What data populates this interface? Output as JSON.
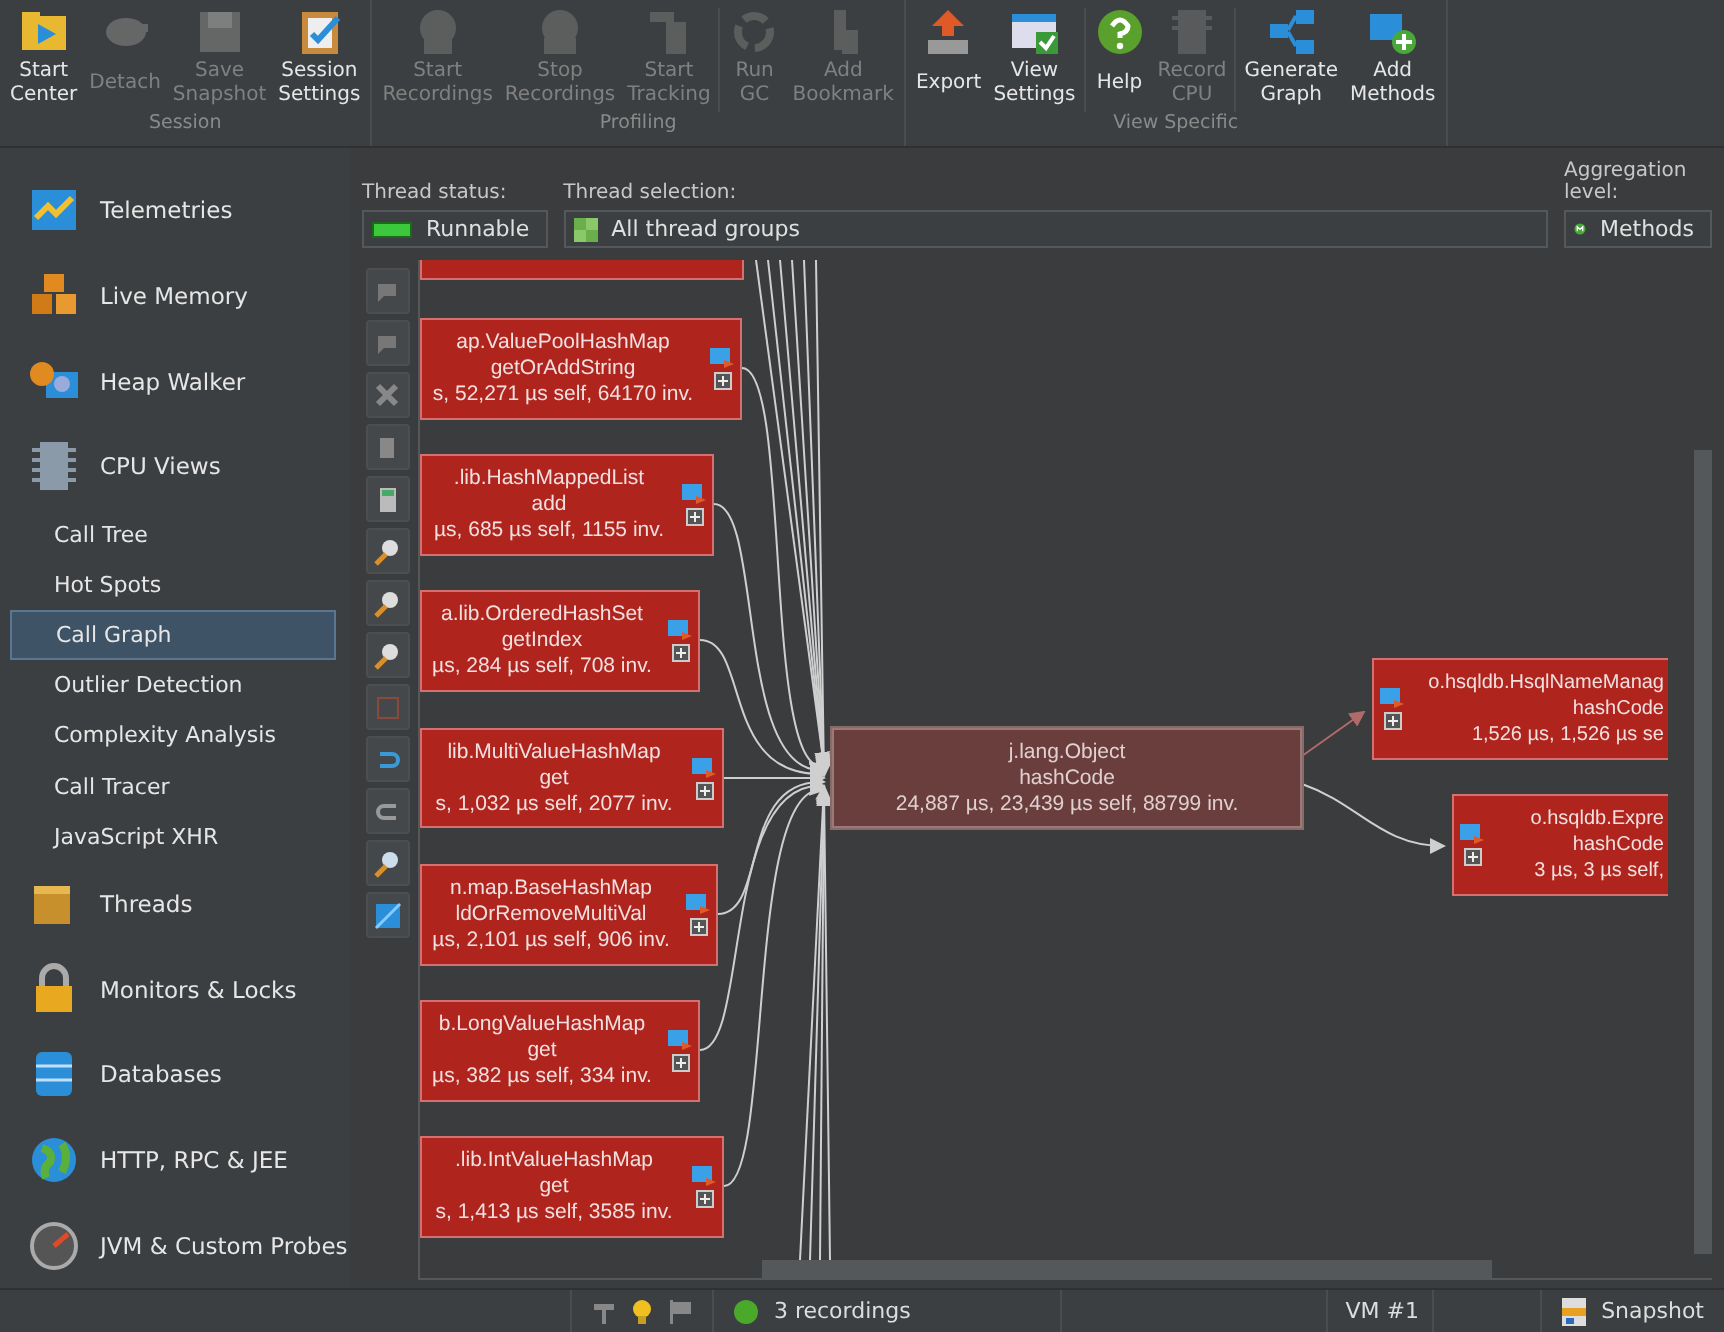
{
  "toolbar": {
    "groups": [
      {
        "label": "Session",
        "buttons": [
          {
            "label": "Start Center",
            "disabled": false
          },
          {
            "label": "Detach",
            "disabled": true
          },
          {
            "label": "Save Snapshot",
            "disabled": true
          },
          {
            "label": "Session Settings",
            "disabled": false
          }
        ]
      },
      {
        "label": "Profiling",
        "buttons": [
          {
            "label": "Start Recordings",
            "disabled": true
          },
          {
            "label": "Stop Recordings",
            "disabled": true
          },
          {
            "label": "Start Tracking",
            "disabled": true
          },
          {
            "label": "Run GC",
            "disabled": true
          },
          {
            "label": "Add Bookmark",
            "disabled": true
          }
        ]
      },
      {
        "label": "View Specific",
        "buttons": [
          {
            "label": "Export",
            "disabled": false
          },
          {
            "label": "View Settings",
            "disabled": false
          },
          {
            "label": "Help",
            "disabled": false
          },
          {
            "label": "Record CPU",
            "disabled": true
          },
          {
            "label": "Generate Graph",
            "disabled": false
          },
          {
            "label": "Add Methods",
            "disabled": false
          }
        ]
      }
    ]
  },
  "sidebar": {
    "items": [
      {
        "label": "Telemetries",
        "kind": "section",
        "selected": false
      },
      {
        "label": "Live Memory",
        "kind": "section",
        "selected": false
      },
      {
        "label": "Heap Walker",
        "kind": "section",
        "selected": false
      },
      {
        "label": "CPU Views",
        "kind": "section",
        "selected": false
      },
      {
        "label": "Call Tree",
        "kind": "sub",
        "selected": false
      },
      {
        "label": "Hot Spots",
        "kind": "sub",
        "selected": false
      },
      {
        "label": "Call Graph",
        "kind": "sub",
        "selected": true
      },
      {
        "label": "Outlier Detection",
        "kind": "sub",
        "selected": false
      },
      {
        "label": "Complexity Analysis",
        "kind": "sub",
        "selected": false
      },
      {
        "label": "Call Tracer",
        "kind": "sub",
        "selected": false
      },
      {
        "label": "JavaScript XHR",
        "kind": "sub",
        "selected": false
      },
      {
        "label": "Threads",
        "kind": "section",
        "selected": false
      },
      {
        "label": "Monitors & Locks",
        "kind": "section",
        "selected": false
      },
      {
        "label": "Databases",
        "kind": "section",
        "selected": false
      },
      {
        "label": "HTTP, RPC & JEE",
        "kind": "section",
        "selected": false
      },
      {
        "label": "JVM & Custom Probes",
        "kind": "section",
        "selected": false
      }
    ]
  },
  "filters": {
    "thread_status": {
      "label": "Thread status:",
      "value": "Runnable"
    },
    "thread_selection": {
      "label": "Thread selection:",
      "value": "All thread groups"
    },
    "aggregation_level": {
      "label": "Aggregation level:",
      "value": "Methods"
    }
  },
  "graph": {
    "nodes": [
      {
        "kind": "caller",
        "selected": false
      },
      {
        "kind": "caller",
        "selected": false,
        "lines": [
          "ap.ValuePoolHashMap",
          "getOrAddString",
          "s, 52,271 µs self, 64170 inv."
        ]
      },
      {
        "kind": "caller",
        "selected": false,
        "lines": [
          ".lib.HashMappedList",
          "add",
          "µs, 685 µs self, 1155 inv."
        ]
      },
      {
        "kind": "caller",
        "selected": false,
        "lines": [
          "a.lib.OrderedHashSet",
          "getIndex",
          "µs, 284 µs self, 708 inv."
        ]
      },
      {
        "kind": "caller",
        "selected": false,
        "lines": [
          "lib.MultiValueHashMap",
          "get",
          "s, 1,032 µs self, 2077 inv."
        ]
      },
      {
        "kind": "caller",
        "selected": false,
        "lines": [
          "n.map.BaseHashMap",
          "ldOrRemoveMultiVal",
          "µs, 2,101 µs self, 906 inv."
        ]
      },
      {
        "kind": "caller",
        "selected": false,
        "lines": [
          "b.LongValueHashMap",
          "get",
          "µs, 382 µs self, 334 inv."
        ]
      },
      {
        "kind": "caller",
        "selected": false,
        "lines": [
          ".lib.IntValueHashMap",
          "get",
          "s, 1,413 µs self, 3585 inv."
        ]
      },
      {
        "kind": "focus",
        "selected": true,
        "lines": [
          "j.lang.Object",
          "hashCode",
          "24,887 µs, 23,439 µs self, 88799 inv."
        ]
      },
      {
        "kind": "callee",
        "selected": false,
        "lines": [
          "o.hsqldb.HsqlNameManag",
          "hashCode",
          "1,526 µs, 1,526 µs se"
        ]
      },
      {
        "kind": "callee",
        "selected": false,
        "lines": [
          "o.hsqldb.Expre",
          "hashCode",
          "3 µs, 3 µs self,"
        ]
      }
    ]
  },
  "status_bar": {
    "recordings": "3 recordings",
    "vm": "VM #1",
    "mode": "Snapshot"
  }
}
